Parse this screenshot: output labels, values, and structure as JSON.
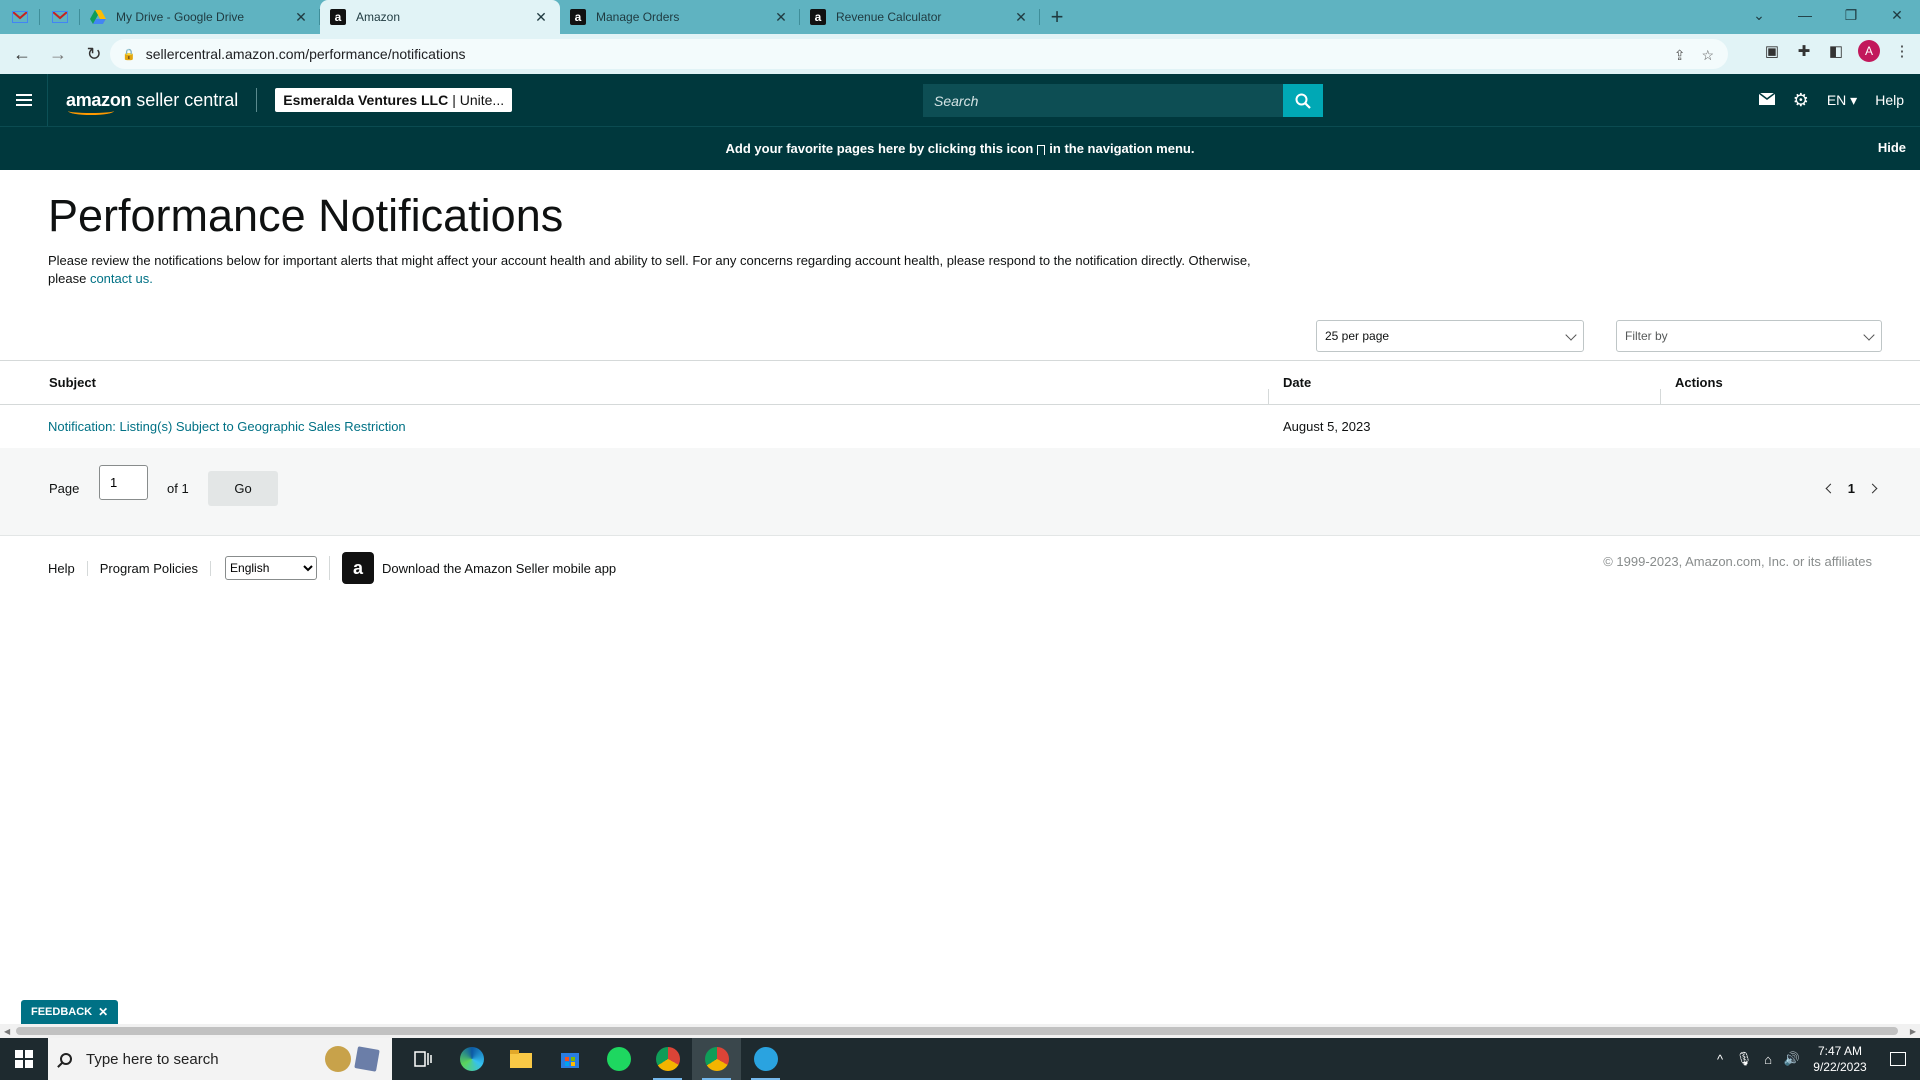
{
  "browser": {
    "tabs": [
      {
        "title": "My Drive - Google Drive",
        "icon": "google-drive-icon"
      },
      {
        "title": "Amazon",
        "icon": "amazon-icon",
        "active": true
      },
      {
        "title": "Manage Orders",
        "icon": "amazon-icon"
      },
      {
        "title": "Revenue Calculator",
        "icon": "amazon-icon"
      }
    ],
    "url": "sellercentral.amazon.com/performance/notifications",
    "avatar_letter": "A",
    "accent_color": "#5fb3c1"
  },
  "header": {
    "brand_bold": "amazon",
    "brand_rest": " seller central",
    "account_name": "Esmeralda Ventures LLC",
    "account_region": "| Unite...",
    "search_placeholder": "Search",
    "language": "EN",
    "help": "Help",
    "background_color": "#00383d"
  },
  "banner": {
    "text_before": "Add your favorite pages here by clicking this icon",
    "text_after": "in the navigation menu.",
    "hide": "Hide"
  },
  "main": {
    "title": "Performance Notifications",
    "intro": "Please review the notifications below for important alerts that might affect your account health and ability to sell. For any concerns regarding account health, please respond to the notification directly. Otherwise, please",
    "contact_link": "contact us.",
    "per_page": "25 per page",
    "filter_placeholder": "Filter by",
    "columns": {
      "subject": "Subject",
      "date": "Date",
      "actions": "Actions"
    },
    "rows": [
      {
        "subject": "Notification: Listing(s) Subject to Geographic Sales Restriction",
        "date": "August 5, 2023"
      }
    ],
    "pager": {
      "page_label": "Page",
      "page_value": "1",
      "of_label": "of 1",
      "go": "Go",
      "current": "1"
    }
  },
  "footer": {
    "help": "Help",
    "policies": "Program Policies",
    "language": "English",
    "app_text": "Download the Amazon Seller mobile app",
    "copyright": "© 1999-2023, Amazon.com, Inc. or its affiliates"
  },
  "feedback": "FEEDBACK",
  "taskbar": {
    "search_placeholder": "Type here to search",
    "time": "7:47 AM",
    "date": "9/22/2023"
  }
}
